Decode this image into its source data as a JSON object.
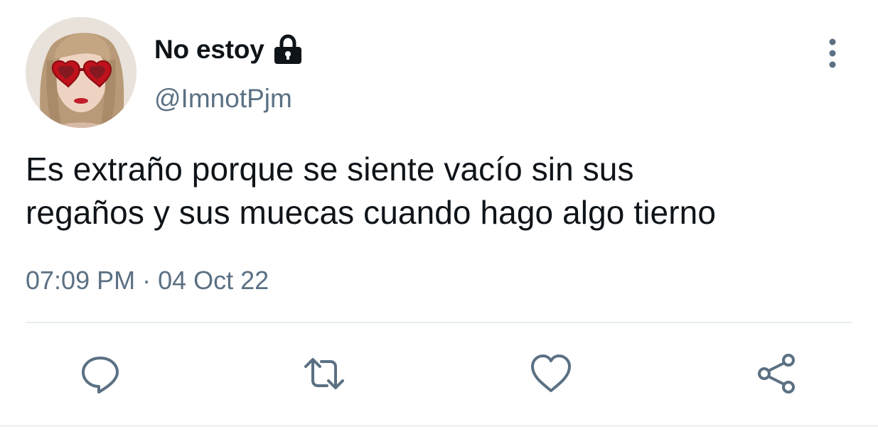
{
  "user": {
    "display_name": "No estoy",
    "handle": "@ImnotPjm",
    "protected_icon": "lock-icon",
    "avatar": "avatar"
  },
  "tweet": {
    "text_line1": "Es extraño porque se siente vacío sin sus",
    "text_line2": "regaños y sus muecas cuando hago algo tierno",
    "time": "07:09 PM",
    "separator": "·",
    "date": "04 Oct 22"
  },
  "actions": [
    {
      "icon": "reply-icon"
    },
    {
      "icon": "retweet-icon"
    },
    {
      "icon": "like-icon"
    },
    {
      "icon": "share-icon"
    }
  ],
  "menu": {
    "icon": "more-vertical-icon"
  },
  "colors": {
    "text_primary": "#0f1419",
    "text_secondary": "#5b7083",
    "divider": "#e6ecf0"
  }
}
